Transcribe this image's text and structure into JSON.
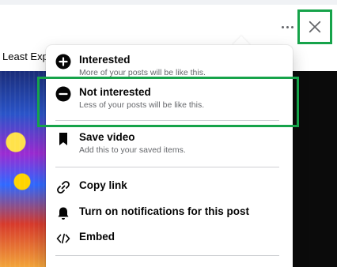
{
  "post": {
    "snippet": "Least Exp"
  },
  "menu": {
    "items": [
      {
        "label": "Interested",
        "description": "More of your posts will be like this.",
        "icon": "plus-circle-icon"
      },
      {
        "label": "Not interested",
        "description": "Less of your posts will be like this.",
        "icon": "minus-circle-icon"
      },
      {
        "label": "Save video",
        "description": "Add this to your saved items.",
        "icon": "bookmark-icon"
      },
      {
        "label": "Copy link",
        "icon": "link-icon"
      },
      {
        "label": "Turn on notifications for this post",
        "icon": "bell-icon"
      },
      {
        "label": "Embed",
        "icon": "code-icon"
      }
    ]
  },
  "colors": {
    "highlight": "#16a34a",
    "secondary_text": "#65676b",
    "primary_text": "#050505"
  }
}
